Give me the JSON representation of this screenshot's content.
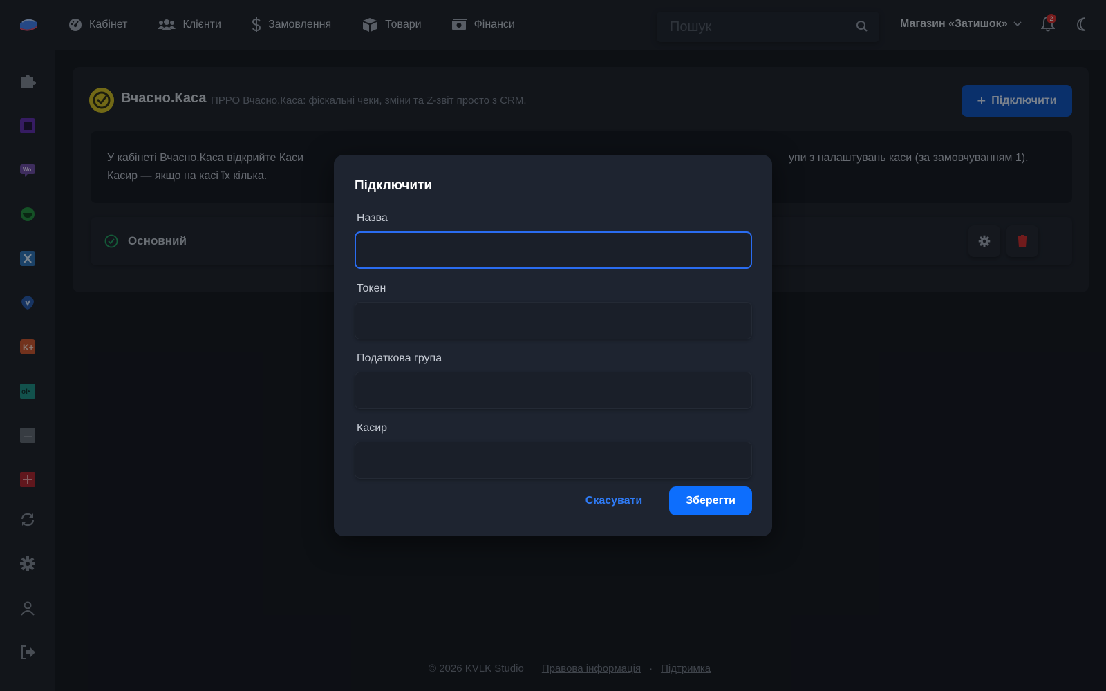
{
  "topbar": {
    "nav": [
      {
        "label": "Кабінет",
        "icon": "dashboard-icon"
      },
      {
        "label": "Клієнти",
        "icon": "users-icon"
      },
      {
        "label": "Замовлення",
        "icon": "dollar-icon"
      },
      {
        "label": "Товари",
        "icon": "box-icon"
      },
      {
        "label": "Фінанси",
        "icon": "money-icon"
      }
    ],
    "search_placeholder": "Пошук",
    "store_name": "Магазин «Затишок»",
    "notifications_count": "2"
  },
  "integration": {
    "title": "Вчасно.Каса",
    "subtitle": "ПРРО Вчасно.Каса: фіскальні чеки, зміни та Z-звіт просто з CRM.",
    "connect_label": "Підключити",
    "info_line1_left": "У кабінеті Вчасно.Каса відкрийте Каси",
    "info_line1_right": "упи з налаштувань каси (за замовчуванням 1).",
    "info_line2": "Касир — якщо на касі їх кілька.",
    "items": [
      {
        "name": "Основний",
        "status": "active"
      }
    ]
  },
  "modal": {
    "title": "Підключити",
    "fields": [
      {
        "label": "Назва",
        "value": ""
      },
      {
        "label": "Токен",
        "value": ""
      },
      {
        "label": "Податкова група",
        "value": ""
      },
      {
        "label": "Касир",
        "value": ""
      }
    ],
    "cancel_label": "Скасувати",
    "save_label": "Зберегти"
  },
  "footer": {
    "copyright": "© 2026 KVLK Studio",
    "legal_link": "Правова інформація",
    "separator": "·",
    "support_link": "Підтримка"
  },
  "colors": {
    "accent": "#0d6efd",
    "danger": "#d42a2a",
    "success": "#1e9e5e",
    "brand_yellow": "#c8b71e"
  }
}
